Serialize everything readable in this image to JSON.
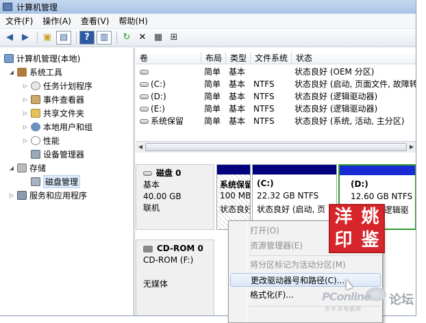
{
  "window": {
    "title": "计算机管理"
  },
  "menu": [
    "文件(F)",
    "操作(A)",
    "查看(V)",
    "帮助(H)"
  ],
  "toolbar": [
    "back-arrow-icon",
    "forward-arrow-icon",
    "up-folder-icon",
    "show-tree-icon",
    "help-icon",
    "properties-icon",
    "refresh-icon",
    "delete-icon",
    "properties-sheet-icon",
    "export-icon"
  ],
  "tree": {
    "root": "计算机管理(本地)",
    "system_tools": "系统工具",
    "task_scheduler": "任务计划程序",
    "event_viewer": "事件查看器",
    "shared_folders": "共享文件夹",
    "local_users": "本地用户和组",
    "performance": "性能",
    "device_manager": "设备管理器",
    "storage": "存储",
    "disk_management": "磁盘管理",
    "services_apps": "服务和应用程序"
  },
  "volume_table": {
    "headers": [
      "卷",
      "布局",
      "类型",
      "文件系统",
      "状态"
    ],
    "rows": [
      {
        "volume": "",
        "layout": "简单",
        "type": "基本",
        "fs": "",
        "status": "状态良好 (OEM 分区)"
      },
      {
        "volume": "(C:)",
        "layout": "简单",
        "type": "基本",
        "fs": "NTFS",
        "status": "状态良好 (启动, 页面文件, 故障转"
      },
      {
        "volume": "(D:)",
        "layout": "简单",
        "type": "基本",
        "fs": "NTFS",
        "status": "状态良好 (逻辑驱动器)"
      },
      {
        "volume": "(E:)",
        "layout": "简单",
        "type": "基本",
        "fs": "NTFS",
        "status": "状态良好 (逻辑驱动器)"
      },
      {
        "volume": "系统保留",
        "layout": "简单",
        "type": "基本",
        "fs": "NTFS",
        "status": "状态良好 (系统, 活动, 主分区)"
      }
    ]
  },
  "disk0": {
    "name": "磁盘 0",
    "type": "基本",
    "size": "40.00 GB",
    "status": "联机",
    "partitions": [
      {
        "label": "系统保留",
        "size": "100 MB",
        "status": "状态良好"
      },
      {
        "label": "(C:)",
        "size": "22.32 GB NTFS",
        "status": "状态良好 (启动, 页"
      },
      {
        "label": "(D:)",
        "size": "12.60 GB NTFS",
        "status": "(逻辑驱"
      }
    ]
  },
  "cdrom0": {
    "name": "CD-ROM 0",
    "drive": "CD-ROM (F:)",
    "media": "无媒体"
  },
  "context_menu": {
    "open": "打开(O)",
    "explore": "资源管理器(E)",
    "mark_active": "将分区标记为活动分区(M)",
    "change_letter": "更改驱动器号和路径(C)...",
    "format": "格式化(F)..."
  },
  "seal": {
    "chars": [
      "洋",
      "姚",
      "印",
      "鉴"
    ],
    "color": "#d6262b"
  },
  "watermark": {
    "brand": "PConline",
    "forum": "论坛",
    "sub": "太平洋电脑网"
  },
  "colors": {
    "primary_partition_bar": "#00007c",
    "selected_partition_border": "#2a9c2a",
    "selection": "#dcebfc"
  }
}
